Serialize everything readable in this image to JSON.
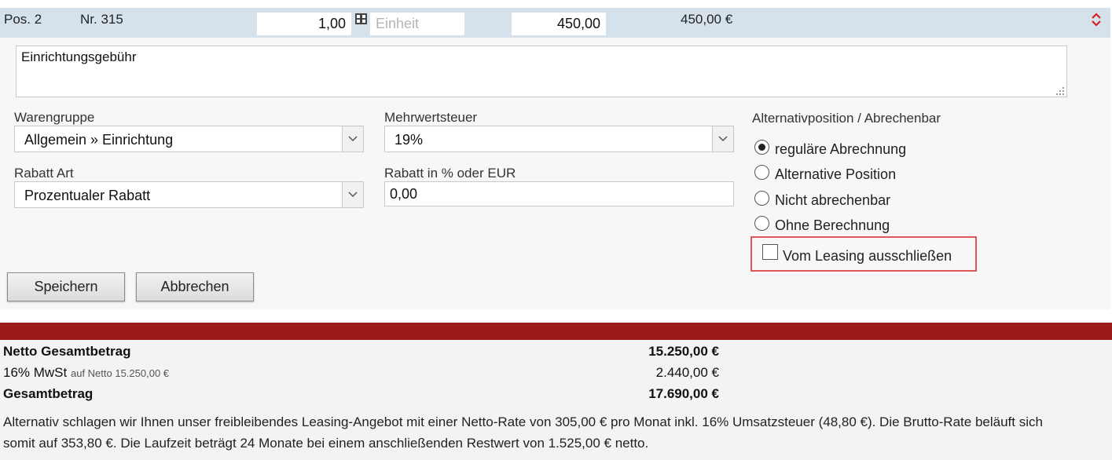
{
  "position": {
    "pos_label": "Pos. 2",
    "nr_label": "Nr. 315",
    "quantity": "1,00",
    "unit_placeholder": "Einheit",
    "unit_price": "450,00",
    "total": "450,00 €"
  },
  "description": "Einrichtungsgebühr",
  "form": {
    "warengruppe_label": "Warengruppe",
    "warengruppe_value": "Allgemein » Einrichtung",
    "mwst_label": "Mehrwertsteuer",
    "mwst_value": "19%",
    "rabatt_art_label": "Rabatt Art",
    "rabatt_art_value": "Prozentualer Rabatt",
    "rabatt_value_label": "Rabatt in % oder EUR",
    "rabatt_value": "0,00",
    "alt_label": "Alternativposition / Abrechenbar",
    "radios": [
      {
        "label": "reguläre Abrechnung",
        "checked": true
      },
      {
        "label": "Alternative Position",
        "checked": false
      },
      {
        "label": "Nicht abrechenbar",
        "checked": false
      },
      {
        "label": "Ohne Berechnung",
        "checked": false
      }
    ],
    "leasing_checkbox_label": "Vom Leasing ausschließen",
    "save_label": "Speichern",
    "cancel_label": "Abbrechen"
  },
  "totals": {
    "netto_label": "Netto Gesamtbetrag",
    "netto_value": "15.250,00 €",
    "mwst_label": "16% MwSt",
    "mwst_sub": "auf Netto 15.250,00 €",
    "mwst_value": "2.440,00 €",
    "gesamt_label": "Gesamtbetrag",
    "gesamt_value": "17.690,00 €"
  },
  "leasing_note_line1": "Alternativ schlagen wir Ihnen unser freibleibendes Leasing-Angebot mit einer Netto-Rate von 305,00 € pro Monat inkl. 16% Umsatzsteuer (48,80 €). Die Brutto-Rate beläuft sich",
  "leasing_note_line2": "somit auf 353,80 €. Die Laufzeit beträgt 24 Monate bei einem anschließenden Restwert von 1.525,00 € netto.",
  "colors": {
    "header_bg": "#d5e2ec",
    "accent_red": "#9b1b1b",
    "highlight_border": "#e0575a"
  }
}
